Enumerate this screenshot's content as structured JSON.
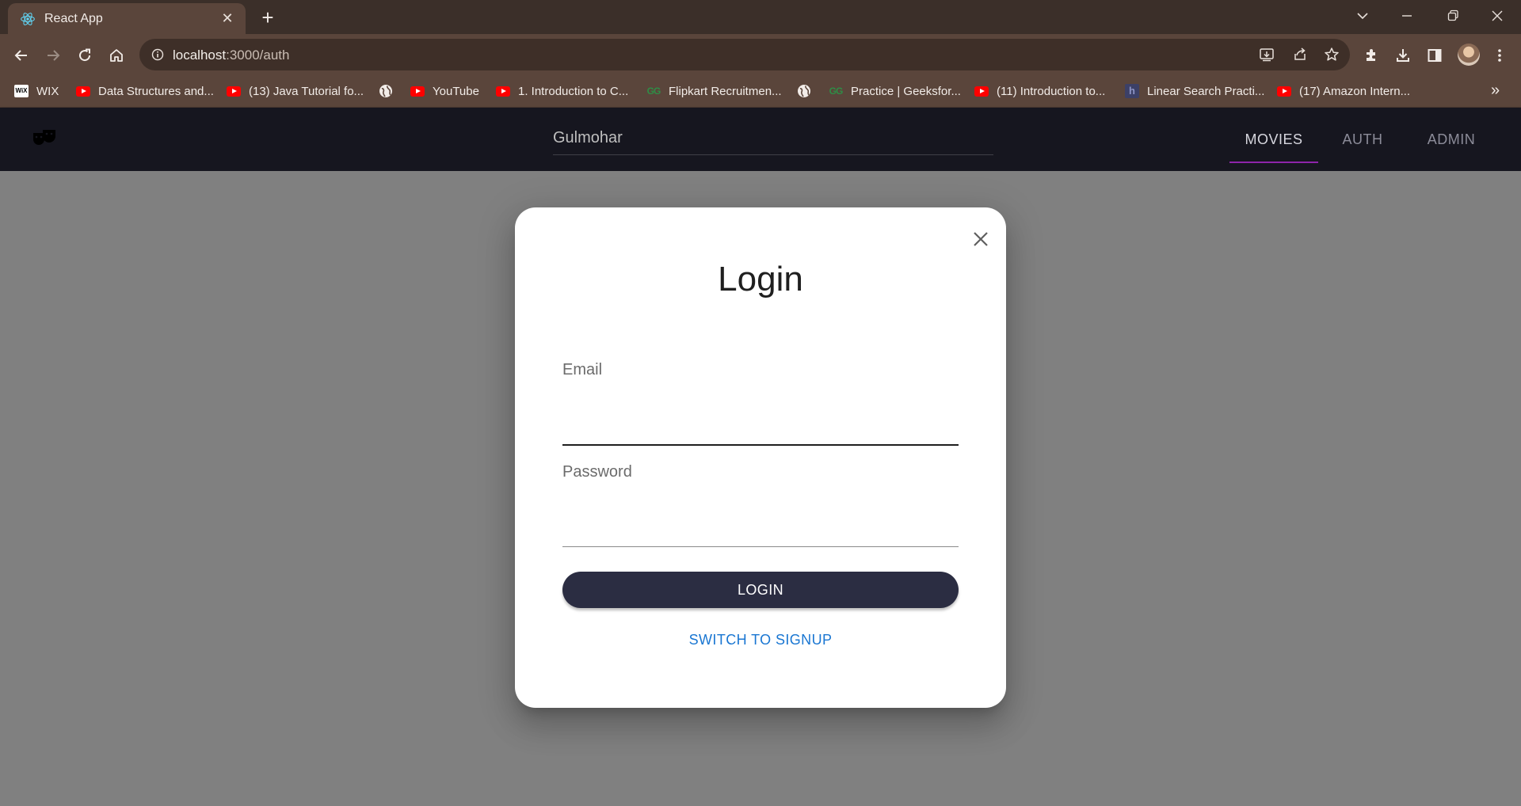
{
  "browser": {
    "tab_title": "React App",
    "tab_favicon": "react-icon",
    "url_host": "localhost",
    "url_path": ":3000/auth",
    "bookmarks": [
      {
        "label": "WIX",
        "icon": "wix-icon"
      },
      {
        "label": "Data Structures and...",
        "icon": "youtube-icon"
      },
      {
        "label": "(13) Java Tutorial fo...",
        "icon": "youtube-icon"
      },
      {
        "label": "",
        "icon": "globe-icon"
      },
      {
        "label": "YouTube",
        "icon": "youtube-icon"
      },
      {
        "label": "1. Introduction to C...",
        "icon": "youtube-icon"
      },
      {
        "label": "Flipkart Recruitmen...",
        "icon": "geeksforgeeks-icon"
      },
      {
        "label": "",
        "icon": "globe-icon"
      },
      {
        "label": "Practice | Geeksfor...",
        "icon": "geeksforgeeks-icon"
      },
      {
        "label": "(11) Introduction to...",
        "icon": "youtube-icon"
      },
      {
        "label": "Linear Search Practi...",
        "icon": "hackerblocks-icon"
      },
      {
        "label": "(17) Amazon Intern...",
        "icon": "youtube-icon"
      }
    ],
    "more_bookmarks": "»"
  },
  "app": {
    "search_placeholder": "Gulmohar",
    "nav_tabs": [
      {
        "label": "MOVIES",
        "active": true
      },
      {
        "label": "AUTH",
        "active": false
      },
      {
        "label": "ADMIN",
        "active": false
      }
    ],
    "accent_color": "#8e24aa"
  },
  "dialog": {
    "title": "Login",
    "email_label": "Email",
    "password_label": "Password",
    "login_button": "LOGIN",
    "switch_link": "SWITCH TO SIGNUP",
    "button_color": "#2b2d42",
    "link_color": "#1976d2"
  }
}
